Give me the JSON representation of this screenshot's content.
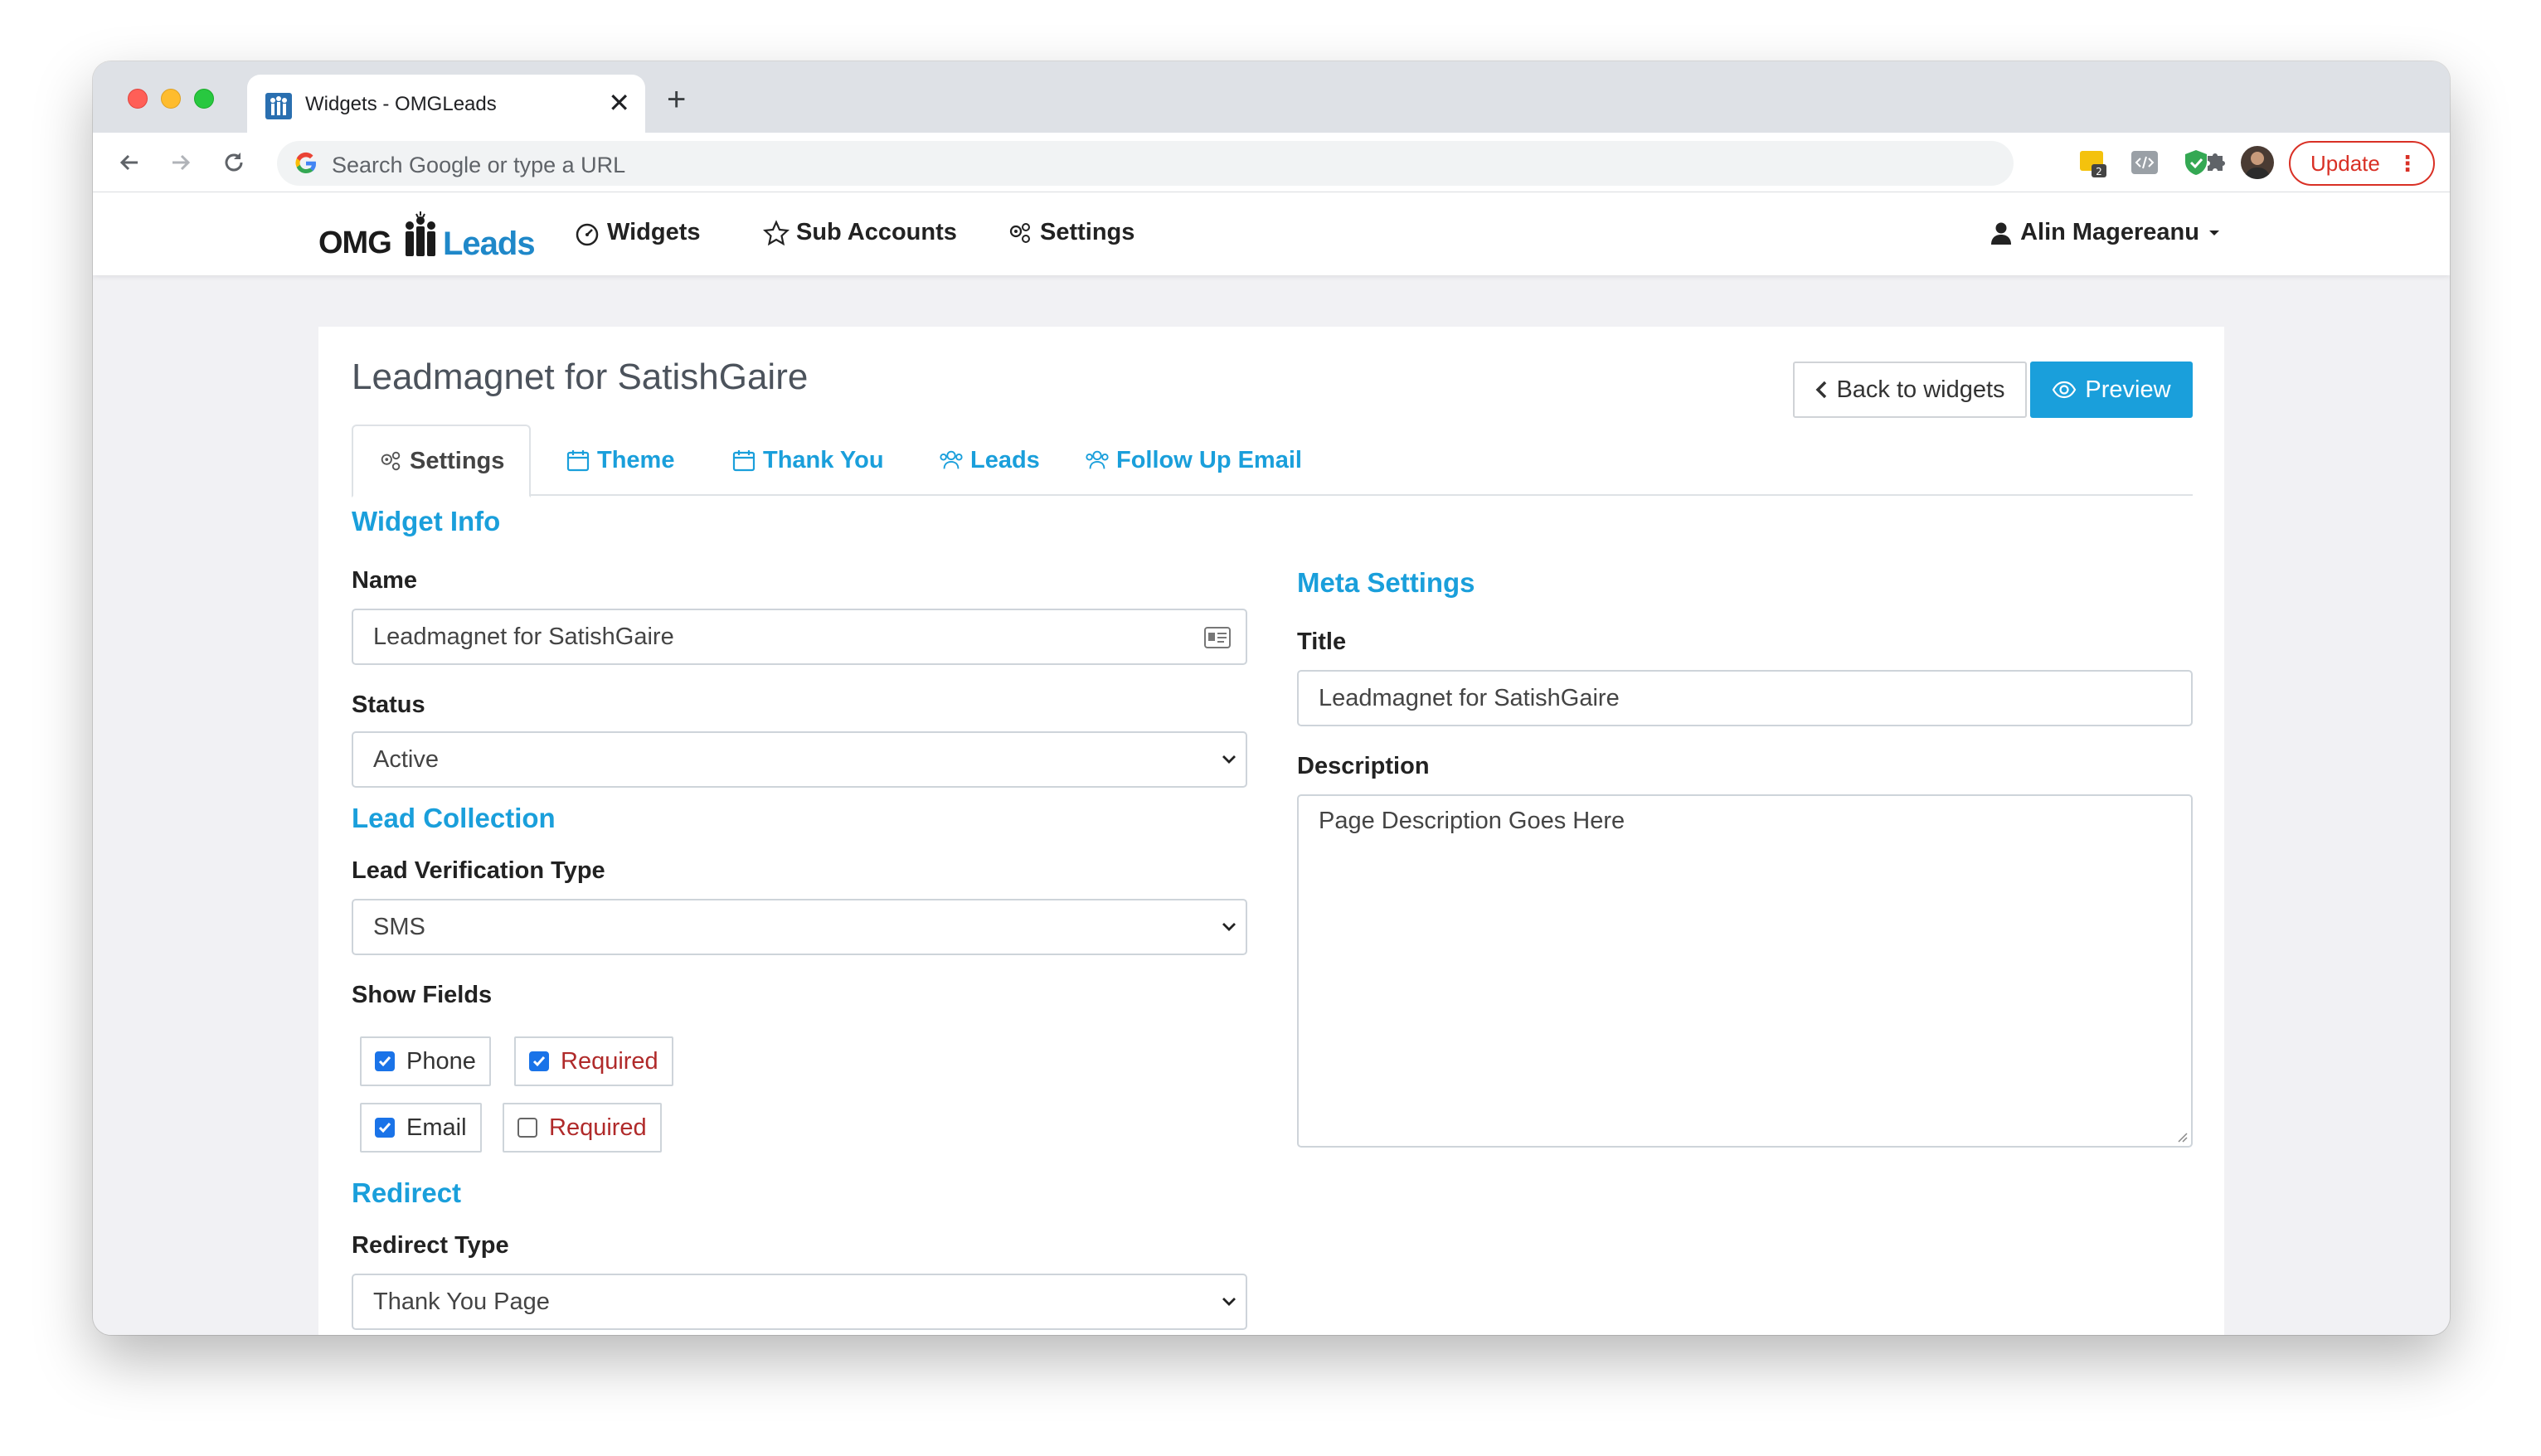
{
  "browser": {
    "tab_title": "Widgets - OMGLeads",
    "tab_close": "✕",
    "new_tab": "+",
    "omnibox_placeholder": "Search Google or type a URL",
    "extension_badge": "2",
    "update_label": "Update"
  },
  "navbar": {
    "logo_omg": "OMG",
    "logo_leads": "Leads",
    "items": [
      {
        "label": "Widgets",
        "icon": "gauge-icon"
      },
      {
        "label": "Sub Accounts",
        "icon": "star-icon"
      },
      {
        "label": "Settings",
        "icon": "gears-icon"
      }
    ],
    "user_name": "Alin Magereanu"
  },
  "card": {
    "title": "Leadmagnet for SatishGaire",
    "back_label": "Back to widgets",
    "preview_label": "Preview",
    "tabs": [
      {
        "label": "Settings",
        "icon": "gears-icon",
        "active": true
      },
      {
        "label": "Theme",
        "icon": "calendar-icon"
      },
      {
        "label": "Thank You",
        "icon": "calendar-icon"
      },
      {
        "label": "Leads",
        "icon": "users-icon"
      },
      {
        "label": "Follow Up Email",
        "icon": "users-icon"
      }
    ]
  },
  "form": {
    "widget_info_heading": "Widget Info",
    "name_label": "Name",
    "name_value": "Leadmagnet for SatishGaire",
    "status_label": "Status",
    "status_value": "Active",
    "lead_collection_heading": "Lead Collection",
    "verification_label": "Lead Verification Type",
    "verification_value": "SMS",
    "show_fields_label": "Show Fields",
    "fields": [
      {
        "label": "Phone",
        "checked": true,
        "required_label": "Required",
        "required_checked": true
      },
      {
        "label": "Email",
        "checked": true,
        "required_label": "Required",
        "required_checked": false
      }
    ],
    "redirect_heading": "Redirect",
    "redirect_type_label": "Redirect Type",
    "redirect_type_value": "Thank You Page",
    "meta_heading": "Meta Settings",
    "meta_title_label": "Title",
    "meta_title_value": "Leadmagnet for SatishGaire",
    "meta_desc_label": "Description",
    "meta_desc_value": "Page Description Goes Here"
  },
  "colors": {
    "accent": "#1a9fdb",
    "required_text": "#b02a2a",
    "update_red": "#d93025"
  }
}
